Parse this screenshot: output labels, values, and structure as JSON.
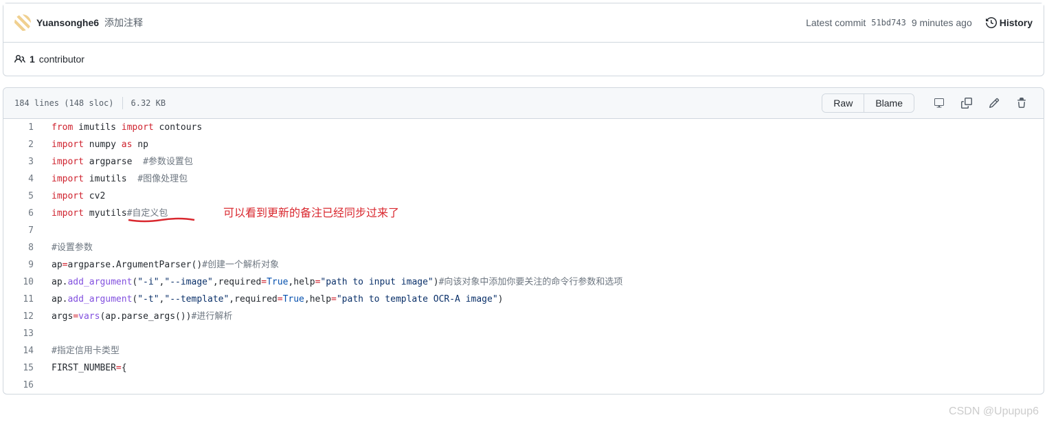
{
  "commit": {
    "author": "Yuansonghe6",
    "message": "添加注释",
    "latest_label": "Latest commit",
    "sha": "51bd743",
    "time": "9 minutes ago",
    "history": "History"
  },
  "contributors": {
    "count": "1",
    "label": "contributor"
  },
  "file": {
    "lines": "184 lines (148 sloc)",
    "size": "6.32 KB",
    "raw": "Raw",
    "blame": "Blame"
  },
  "code": [
    [
      {
        "t": "from",
        "c": "kw-red"
      },
      {
        "t": " imutils "
      },
      {
        "t": "import",
        "c": "kw-red"
      },
      {
        "t": " contours"
      }
    ],
    [
      {
        "t": "import",
        "c": "kw-red"
      },
      {
        "t": " numpy "
      },
      {
        "t": "as",
        "c": "kw-red"
      },
      {
        "t": " np"
      }
    ],
    [
      {
        "t": "import",
        "c": "kw-red"
      },
      {
        "t": " argparse  "
      },
      {
        "t": "#参数设置包",
        "c": "cmt"
      }
    ],
    [
      {
        "t": "import",
        "c": "kw-red"
      },
      {
        "t": " imutils  "
      },
      {
        "t": "#图像处理包",
        "c": "cmt"
      }
    ],
    [
      {
        "t": "import",
        "c": "kw-red"
      },
      {
        "t": " cv2"
      }
    ],
    [
      {
        "t": "import",
        "c": "kw-red"
      },
      {
        "t": " myutils"
      },
      {
        "t": "#自定义包",
        "c": "cmt"
      }
    ],
    [],
    [
      {
        "t": "#设置参数",
        "c": "cmt"
      }
    ],
    [
      {
        "t": "ap"
      },
      {
        "t": "=",
        "c": "kw-red"
      },
      {
        "t": "argparse.ArgumentParser()"
      },
      {
        "t": "#创建一个解析对象",
        "c": "cmt"
      }
    ],
    [
      {
        "t": "ap."
      },
      {
        "t": "add_argument",
        "c": "kw-purple"
      },
      {
        "t": "("
      },
      {
        "t": "\"-i\"",
        "c": "str-blue"
      },
      {
        "t": ","
      },
      {
        "t": "\"--image\"",
        "c": "str-blue"
      },
      {
        "t": ","
      },
      {
        "t": "required"
      },
      {
        "t": "=",
        "c": "kw-red"
      },
      {
        "t": "True",
        "c": "const-blue"
      },
      {
        "t": ","
      },
      {
        "t": "help"
      },
      {
        "t": "=",
        "c": "kw-red"
      },
      {
        "t": "\"path to input image\"",
        "c": "str-blue"
      },
      {
        "t": ")"
      },
      {
        "t": "#向该对象中添加你要关注的命令行参数和选项",
        "c": "cmt"
      }
    ],
    [
      {
        "t": "ap."
      },
      {
        "t": "add_argument",
        "c": "kw-purple"
      },
      {
        "t": "("
      },
      {
        "t": "\"-t\"",
        "c": "str-blue"
      },
      {
        "t": ","
      },
      {
        "t": "\"--template\"",
        "c": "str-blue"
      },
      {
        "t": ","
      },
      {
        "t": "required"
      },
      {
        "t": "=",
        "c": "kw-red"
      },
      {
        "t": "True",
        "c": "const-blue"
      },
      {
        "t": ","
      },
      {
        "t": "help"
      },
      {
        "t": "=",
        "c": "kw-red"
      },
      {
        "t": "\"path to template OCR-A image\"",
        "c": "str-blue"
      },
      {
        "t": ")"
      }
    ],
    [
      {
        "t": "args"
      },
      {
        "t": "=",
        "c": "kw-red"
      },
      {
        "t": "vars",
        "c": "kw-purple"
      },
      {
        "t": "(ap.parse_args())"
      },
      {
        "t": "#进行解析",
        "c": "cmt"
      }
    ],
    [],
    [
      {
        "t": "#指定信用卡类型",
        "c": "cmt"
      }
    ],
    [
      {
        "t": "FIRST_NUMBER"
      },
      {
        "t": "=",
        "c": "kw-red"
      },
      {
        "t": "{"
      }
    ],
    []
  ],
  "annotation": "可以看到更新的备注已经同步过来了",
  "watermark": "CSDN @Upupup6"
}
